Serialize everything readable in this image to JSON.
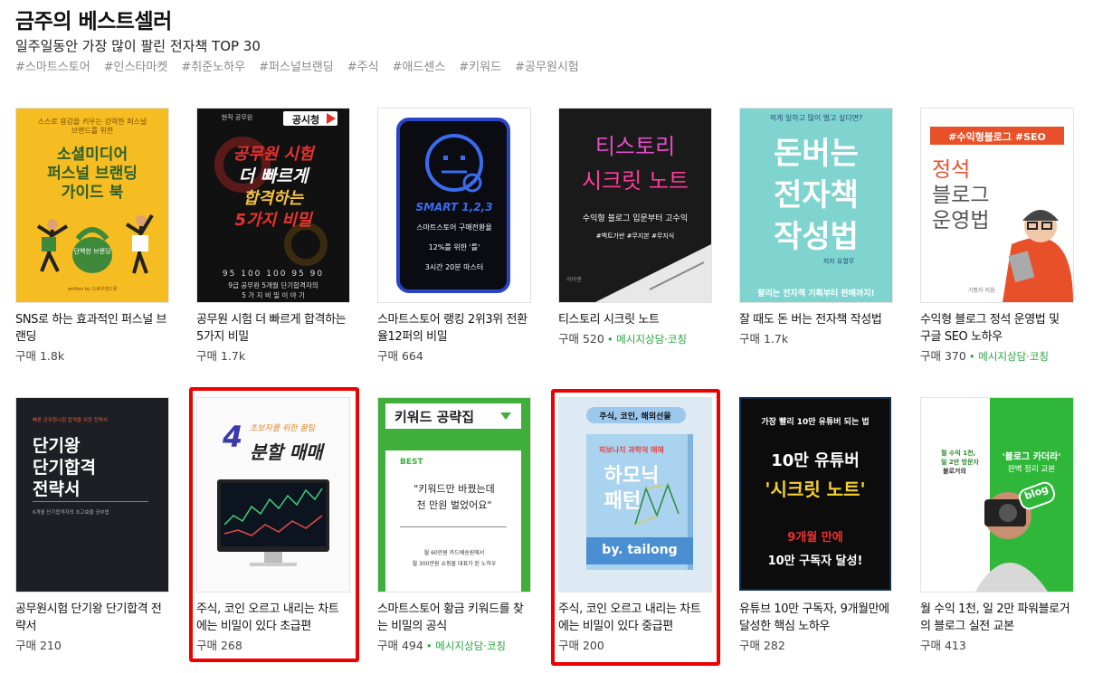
{
  "header": {
    "title": "금주의 베스트셀러",
    "subtitle": "일주일동안 가장 많이 팔린 전자책 TOP 30",
    "tags": [
      "#스마트스토어",
      "#인스타마켓",
      "#취준노하우",
      "#퍼스널브랜딩",
      "#주식",
      "#애드센스",
      "#키워드",
      "#공무원시험"
    ]
  },
  "books": [
    {
      "title": "SNS로 하는 효과적인 퍼스널 브랜딩",
      "sales": "구매 1.8k",
      "extra": "",
      "cover": {
        "top": "스스로 용감을 키우는 강력한 퍼스널 브랜드를 위한",
        "main1": "소셜미디어",
        "main2": "퍼스널 브랜딩",
        "main3": "가이드 북",
        "badge": "단백한 브랜딩",
        "bottom": "written by 드로우앤드류"
      }
    },
    {
      "title": "공무원 시험 더 빠르게 합격하는 5가지 비밀",
      "sales": "구매 1.7k",
      "extra": "",
      "cover": {
        "top": "현직 공무원",
        "logo": "공시청",
        "main1": "공무원 시험",
        "main2": "더 빠르게",
        "main3": "합격하는",
        "main4": "5가지 비밀",
        "bottom": "95 100 100 95 90",
        "bottom2": "9급 공무원 5개월 단기합격자의",
        "bottom3": "5 가 지  비 밀  이 야 기"
      }
    },
    {
      "title": "스마트스토어 랭킹 2위3위 전환율12퍼의 비밀",
      "sales": "구매 664",
      "extra": "",
      "cover": {
        "main1": "SMART 1,2,3",
        "line1": "스마트스토어 구매전환율",
        "line2": "12%를 위한 '틀'",
        "line3": "3시간 20분 마스터"
      }
    },
    {
      "title": "티스토리 시크릿 노트",
      "sales": "구매 520",
      "extra": "• 메시지상담·코칭",
      "cover": {
        "main1": "티스토리",
        "main2": "시크릿 노트",
        "sub": "수익형 블로그 입문부터 고수익",
        "tags": "#백트가반  #무지본  #무지식",
        "author": "이아렌"
      }
    },
    {
      "title": "잘 때도 돈 버는 전자책 작성법",
      "sales": "구매 1.7k",
      "extra": "",
      "cover": {
        "top": "적게 일하고 많이 벌고 싶다면?",
        "main1": "돈버는",
        "main2": "전자책",
        "main3": "작성법",
        "author": "저자 유열무",
        "bottom": "팔리는 전자책 기획부터 판매까지!"
      }
    },
    {
      "title": "수익형 블로그 정석 운영법 및 구글 SEO 노하우",
      "sales": "구매 370",
      "extra": "• 메시지상담·코칭",
      "cover": {
        "top": "#수익형블로그 #SEO",
        "main1": "정석",
        "main2": "블로그",
        "main3": "운영법",
        "author": "가봤자 지음"
      }
    },
    {
      "title": "공무원시험 단기왕 단기합격 전략서",
      "sales": "구매 210",
      "extra": "",
      "cover": {
        "top": "빠른 공무원시험 합격을 위한 전략서",
        "main1": "단기왕",
        "main2": "단기합격",
        "main3": "전략서",
        "bottom": "6개월 단기합격자의 초고효율 공부법"
      }
    },
    {
      "title": "주식, 코인 오르고 내리는 차트에는 비밀이 있다 초급편",
      "sales": "구매 268",
      "extra": "",
      "cover": {
        "top": "초보자를 위한 꿀팁",
        "num": "4",
        "main1": "분할 매매"
      }
    },
    {
      "title": "스마트스토어 황금 키워드를 찾는 비밀의 공식",
      "sales": "구매 494",
      "extra": "• 메시지상담·코칭",
      "cover": {
        "top": "키워드 공략집",
        "best": "BEST",
        "quote1": "\"키워드만 바꿨는데",
        "quote2": "천 만원 벌었어요\"",
        "line1": "월 60만원 카드배송원에서",
        "line2": "월 300만원 쇼핑몰 대표가 된 노하우"
      }
    },
    {
      "title": "주식, 코인 오르고 내리는 차트에는 비밀이 있다 중급편",
      "sales": "구매 200",
      "extra": "",
      "cover": {
        "top": "주식, 코인, 해외선물",
        "sub": "피보나치 과학적 매매",
        "main1": "하모닉",
        "main2": "패턴",
        "author": "by. tailong"
      }
    },
    {
      "title": "유튜브 10만 구독자, 9개월만에 달성한 핵심 노하우",
      "sales": "구매 282",
      "extra": "",
      "cover": {
        "top": "가장 빨리 10만 유튜버 되는 법",
        "main1": "10만 유튜버",
        "main2": "'시크릿 노트'",
        "line1": "9개월 만에",
        "line2": "10만 구독자 달성!"
      }
    },
    {
      "title": "월 수익 1천, 일 2만 파워블로거의 블로그 실전 교본",
      "sales": "구매 413",
      "extra": "",
      "cover": {
        "top1": "월 수익 1천,",
        "top2": "일 2만 방문자",
        "top3": "블로거의",
        "main1": "'블로그 카더라'",
        "main2": "완벽 정리 교본",
        "badge": "blog"
      }
    }
  ],
  "highlight_color": "#ee0000"
}
